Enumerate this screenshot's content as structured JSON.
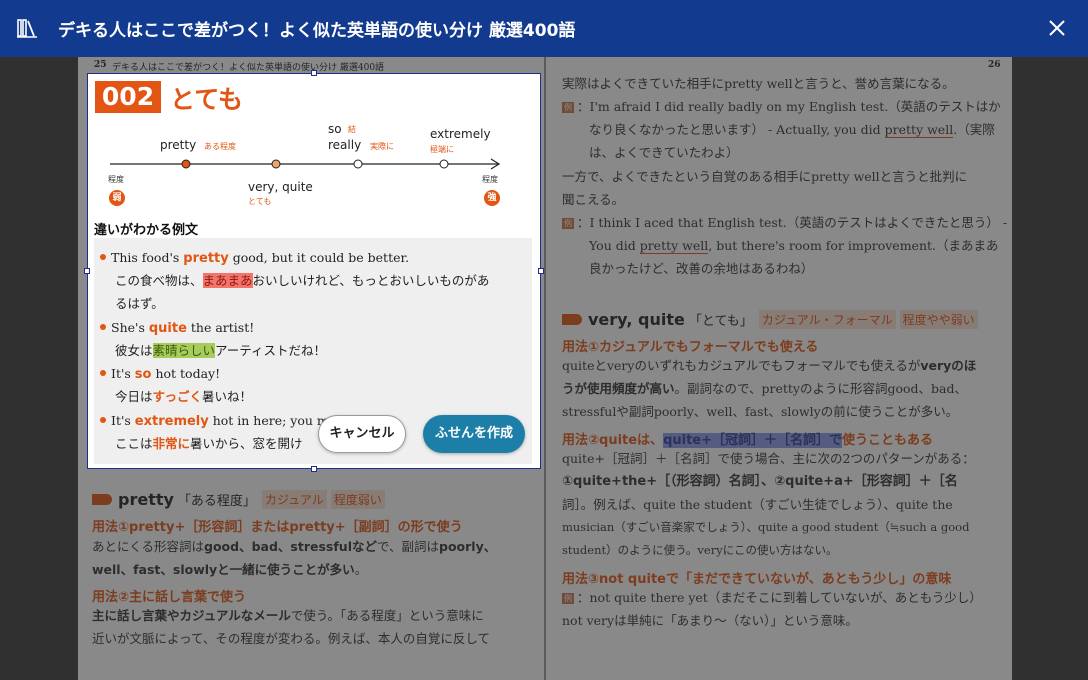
{
  "header": {
    "title": "デキる人はここで差がつく！よく似た英単語の使い分け 厳選400語"
  },
  "left_page": {
    "running_head": "デキる人はここで差がつく！よく似た英単語の使い分け 厳選400語",
    "page_number": "25",
    "section": {
      "word": "pretty",
      "jp": "「ある程度」",
      "tags": [
        "カジュアル",
        "程度弱い"
      ]
    },
    "usage1": "用法①pretty+［形容詞］またはpretty+［副詞］の形で使う",
    "body1_line1": "あとにくる形容詞は",
    "body1_bold1": "good、bad、stressfulなど",
    "body1_mid": "で、副詞は",
    "body1_bold2": "poorly、",
    "body1_line2_bold": "well、fast、slowlyと一緒に使うことが多い",
    "body1_line2_end": "。",
    "usage2": "用法②主に話し言葉で使う",
    "body2_line1_bold": "主に話し言葉やカジュアルなメール",
    "body2_line1_end": "で使う。「ある程度」という意味に",
    "body2_line2": "近いが文脈によって、その程度が変わる。例えば、本人の自覚に反して"
  },
  "right_page": {
    "page_number": "26",
    "line1": "実際はよくできていた相手にpretty wellと言うと、誉め言葉になる。",
    "ex1_mark": "例",
    "ex1_l1": "：I'm afraid I did really badly on my English test.（英語のテストはか",
    "ex1_l2": "なり良くなかったと思います） - Actually, you did ",
    "ex1_l2_u": "pretty well",
    "ex1_l2_end": ".（実際",
    "ex1_l3": "は、よくできていたわよ）",
    "line2": "一方で、よくできたという自覚のある相手にpretty wellと言うと批判に",
    "line3": "聞こえる。",
    "ex2_mark": "例",
    "ex2_l1": "：I think I aced that English test.（英語のテストはよくできたと思う） -",
    "ex2_l2_a": "You did ",
    "ex2_l2_u": "pretty well",
    "ex2_l2_end": ", but there's room for improvement.（まあまあ",
    "ex2_l3": "良かったけど、改善の余地はあるわね）",
    "section": {
      "word": "very, quite",
      "jp": "「とても」",
      "tags": [
        "カジュアル・フォーマル",
        "程度やや弱い"
      ]
    },
    "usage1": "用法①カジュアルでもフォーマルでも使える",
    "body1_l1_a": "quiteとveryのいずれもカジュアルでもフォーマルでも使えるが",
    "body1_l1_b": "veryのほ",
    "body1_l2_b": "うが使用頻度が高い",
    "body1_l2_end": "。副詞なので、prettyのように形容詞good、bad、",
    "body1_l3": "stressfulや副詞poorly、well、fast、slowlyの前に使うことが多い。",
    "usage2_a": "用法②quiteは、",
    "usage2_hl": "quite+［冠詞］＋［名詞］で",
    "usage2_end": "使うこともある",
    "body2_l1": "quite+［冠詞］＋［名詞］で使う場合、主に次の2つのパターンがある：",
    "body2_l2": "①quite+the+［（形容詞）名詞］、②quite+a+［形容詞］＋［名",
    "body2_l3": "詞］。例えば、quite the student（すごい生徒でしょう）、quite the",
    "body2_l4": "musician（すごい音楽家でしょう）、quite a good student（≒such a good",
    "body2_l5": "student）のように使う。veryにこの使い方はない。",
    "usage3": "用法③not quiteで「まだできていないが、あともう少し」の意味",
    "ex3_mark": "例",
    "ex3": "：not quite there yet（まだそこに到着していないが、あともう少し）",
    "body3": "not veryは単純に「あまり〜（ない）」という意味。"
  },
  "selection": {
    "number": "002",
    "headword": "とても",
    "scale": {
      "pretty": "pretty",
      "pretty_sub": "ある程度",
      "so": "so",
      "so_sub": "結",
      "really": "really",
      "really_sub": "実際に",
      "extremely": "extremely",
      "extremely_sub": "極端に",
      "very_quite": "very, quite",
      "very_quite_sub": "とても",
      "left_label": "程度",
      "left_badge": "弱",
      "right_label": "程度",
      "right_badge": "強"
    },
    "examples_title": "違いがわかる例文",
    "ex1_en_a": "This food's ",
    "ex1_kw": "pretty",
    "ex1_en_b": " good, but it could be better.",
    "ex1_jp_a": "この食べ物は、",
    "ex1_jp_hl": "まあまあ",
    "ex1_jp_b": "おいしいけれど、もっとおいしいものがあ",
    "ex1_jp_c": "るはず。",
    "ex2_en_a": "She's ",
    "ex2_kw": "quite",
    "ex2_en_b": " the artist!",
    "ex2_jp_a": "彼女は",
    "ex2_jp_hl": "素晴らしい",
    "ex2_jp_b": "アーティストだね！",
    "ex3_en_a": "It's ",
    "ex3_kw": "so",
    "ex3_en_b": " hot today!",
    "ex3_jp_a": "今日は",
    "ex3_jp_hl": "すっごく",
    "ex3_jp_b": "暑いね！",
    "ex4_en_a": "It's ",
    "ex4_kw": "extremely",
    "ex4_en_b": " hot in here; you m",
    "ex4_en_c": "wi",
    "ex4_jp_a": "ここは",
    "ex4_jp_hl": "非常に",
    "ex4_jp_b": "暑いから、窓を開け",
    "cancel_label": "キャンセル",
    "create_label": "ふせんを作成"
  },
  "colors": {
    "header_bg": "#123a8f",
    "accent_orange": "#e25512",
    "create_button": "#1d7fa8",
    "selection_border": "#1e2e8f"
  },
  "icons": {
    "header_left": "library-books-icon",
    "header_right": "close-icon"
  }
}
